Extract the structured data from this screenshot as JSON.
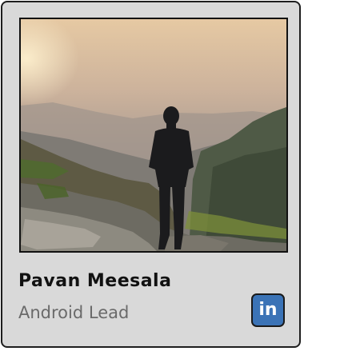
{
  "profile": {
    "name": "Pavan Meesala",
    "role": "Android Lead"
  },
  "social": {
    "linkedin_text": "in"
  },
  "icons": {
    "linkedin": "linkedin-icon"
  },
  "colors": {
    "card_background": "#d9d9d9",
    "card_border": "#1e1e1e",
    "name_text": "#111111",
    "role_text": "#6a6a6a",
    "linkedin_blue": "#3b73b6"
  }
}
